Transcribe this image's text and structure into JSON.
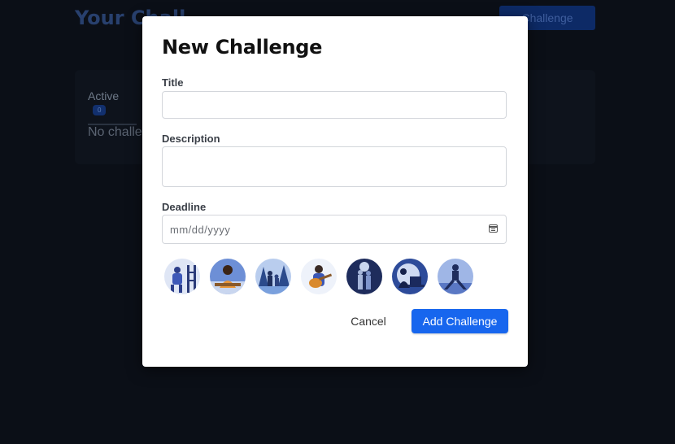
{
  "background": {
    "page_title": "Your Chall",
    "add_button": "Challenge",
    "tab_active": "Active",
    "tab_count": "0",
    "empty_text": "No challe"
  },
  "modal": {
    "title": "New Challenge",
    "title_label": "Title",
    "description_label": "Description",
    "deadline_label": "Deadline",
    "deadline_placeholder": "mm/dd/yyyy",
    "cancel_label": "Cancel",
    "submit_label": "Add Challenge",
    "avatars": [
      "painter",
      "cook",
      "family-walk",
      "guitarist",
      "couple",
      "programmer",
      "athlete"
    ]
  },
  "colors": {
    "primary": "#1766ee",
    "backdrop": "#0b0f17"
  }
}
